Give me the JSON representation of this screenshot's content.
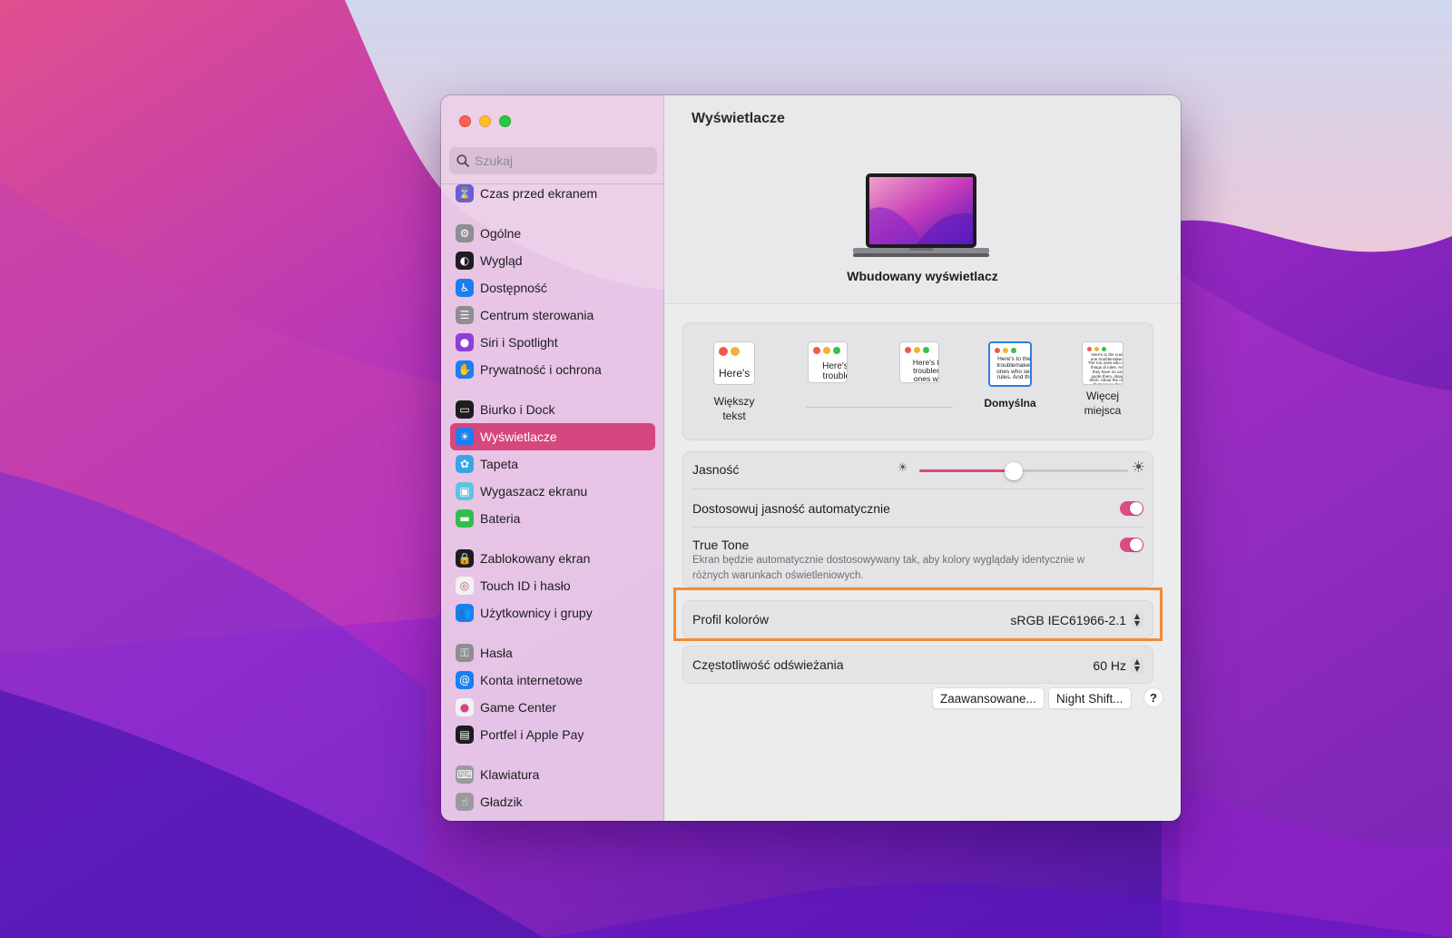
{
  "sidebar": {
    "search_placeholder": "Szukaj",
    "items": [
      {
        "label": "Czas przed ekranem",
        "icon": "hourglass-icon",
        "color": "#6a5fd6"
      },
      {
        "label": "Ogólne",
        "icon": "gear-icon",
        "color": "#8e8e93"
      },
      {
        "label": "Wygląd",
        "icon": "appearance-icon",
        "color": "#1d1d1f"
      },
      {
        "label": "Dostępność",
        "icon": "accessibility-icon",
        "color": "#1a7ff0"
      },
      {
        "label": "Centrum sterowania",
        "icon": "control-center-icon",
        "color": "#8e8e93"
      },
      {
        "label": "Siri i Spotlight",
        "icon": "siri-icon",
        "color": "#8b3fd9"
      },
      {
        "label": "Prywatność i ochrona",
        "icon": "hand-icon",
        "color": "#1a7ff0"
      },
      {
        "label": "Biurko i Dock",
        "icon": "dock-icon",
        "color": "#1d1d1f"
      },
      {
        "label": "Wyświetlacze",
        "icon": "sun-icon",
        "color": "#1a7ff0"
      },
      {
        "label": "Tapeta",
        "icon": "flower-icon",
        "color": "#3aa6e8"
      },
      {
        "label": "Wygaszacz ekranu",
        "icon": "screensaver-icon",
        "color": "#5fc3e4"
      },
      {
        "label": "Bateria",
        "icon": "battery-icon",
        "color": "#30c04a"
      },
      {
        "label": "Zablokowany ekran",
        "icon": "lock-icon",
        "color": "#1d1d1f"
      },
      {
        "label": "Touch ID i hasło",
        "icon": "fingerprint-icon",
        "color": "#f2f2f2"
      },
      {
        "label": "Użytkownicy i grupy",
        "icon": "users-icon",
        "color": "#1a7ff0"
      },
      {
        "label": "Hasła",
        "icon": "key-icon",
        "color": "#8e8e93"
      },
      {
        "label": "Konta internetowe",
        "icon": "at-icon",
        "color": "#1a7ff0"
      },
      {
        "label": "Game Center",
        "icon": "game-center-icon",
        "color": "#f2f2f2"
      },
      {
        "label": "Portfel i Apple Pay",
        "icon": "wallet-icon",
        "color": "#1d1d1f"
      },
      {
        "label": "Klawiatura",
        "icon": "keyboard-icon",
        "color": "#9a9a9f"
      },
      {
        "label": "Gładzik",
        "icon": "trackpad-icon",
        "color": "#9a9a9f"
      }
    ]
  },
  "main": {
    "title": "Wyświetlacze",
    "display_name": "Wbudowany wyświetlacz",
    "resolution_options": [
      {
        "label": "Większy tekst",
        "preview": "Here's"
      },
      {
        "label": "",
        "preview": "Here's to troublem"
      },
      {
        "label": "",
        "preview": "Here's to t troublema ones who"
      },
      {
        "label": "Domyślna",
        "preview": "Here's to the c troublemakers. ones who see t rules. And they"
      },
      {
        "label": "Więcej miejsca",
        "preview": "Here's to the crazy one troublemakers. The rou ones who see things di rules. And they have no can quote them, disagr them. About the only th Because they change th"
      }
    ],
    "brightness_label": "Jasność",
    "brightness_level": 0.45,
    "auto_brightness_label": "Dostosowuj jasność automatycznie",
    "auto_brightness_on": true,
    "true_tone_label": "True Tone",
    "true_tone_description": "Ekran będzie automatycznie dostosowywany tak, aby kolory wyglądały identycznie w różnych warunkach oświetleniowych.",
    "true_tone_on": true,
    "color_profile_label": "Profil kolorów",
    "color_profile_value": "sRGB IEC61966-2.1",
    "refresh_rate_label": "Częstotliwość odświeżania",
    "refresh_rate_value": "60 Hz",
    "advanced_button": "Zaawansowane...",
    "night_shift_button": "Night Shift...",
    "help_button": "?"
  },
  "colors": {
    "accent": "#d6467f",
    "highlight_border": "#f38b34"
  }
}
